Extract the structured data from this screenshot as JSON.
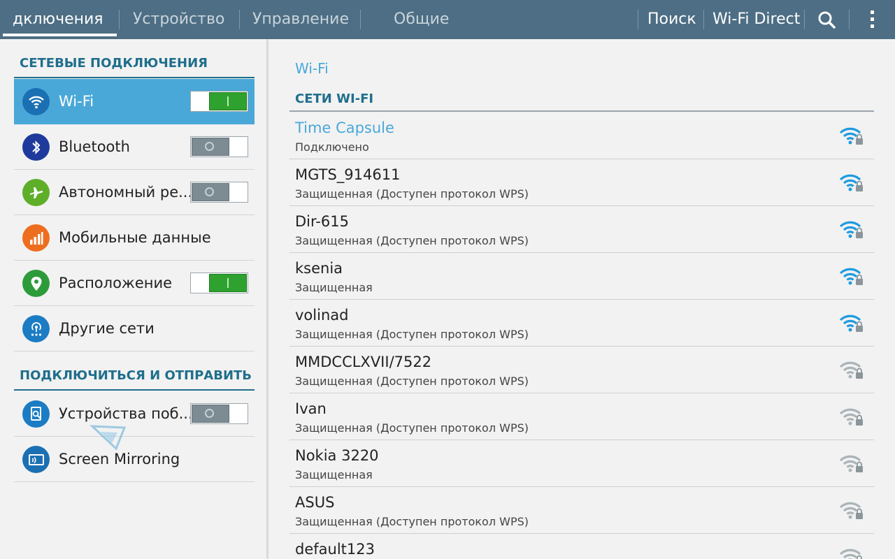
{
  "tabs": [
    {
      "label": "дключения"
    },
    {
      "label": "Устройство"
    },
    {
      "label": "Управление"
    },
    {
      "label": "Общие"
    }
  ],
  "actions": {
    "search_label": "Поиск",
    "wifi_direct_label": "Wi-Fi Direct"
  },
  "icons": {
    "search": "search-icon",
    "menu": "overflow-menu-icon"
  },
  "colors": {
    "topbar": "#4d6e84",
    "accent": "#4aa8d8",
    "section": "#1f6e8c",
    "toggle_on": "#2ea12e",
    "toggle_off": "#7d8b93"
  },
  "sidebar": {
    "section1": "СЕТЕВЫЕ ПОДКЛЮЧЕНИЯ",
    "items": [
      {
        "label": "Wi-Fi",
        "icon": "wifi-icon",
        "toggle": "on",
        "active": true
      },
      {
        "label": "Bluetooth",
        "icon": "bluetooth-icon",
        "toggle": "off"
      },
      {
        "label": "Автономный ре...",
        "icon": "airplane-icon",
        "toggle": "off"
      },
      {
        "label": "Мобильные данные",
        "icon": "mobile-data-icon",
        "toggle": null
      },
      {
        "label": "Расположение",
        "icon": "location-icon",
        "toggle": "on"
      },
      {
        "label": "Другие сети",
        "icon": "other-networks-icon",
        "toggle": null
      }
    ],
    "section2": "ПОДКЛЮЧИТЬСЯ И ОТПРАВИТЬ",
    "items2": [
      {
        "label": "Устройства поб...",
        "icon": "nearby-devices-icon",
        "toggle": "off"
      },
      {
        "label": "Screen Mirroring",
        "icon": "screen-mirroring-icon",
        "toggle": null
      }
    ]
  },
  "main": {
    "breadcrumb": "Wi-Fi",
    "list_header": "СЕТИ WI-FI",
    "networks": [
      {
        "name": "Time Capsule",
        "status": "Подключено",
        "connected": true,
        "signal": "strong"
      },
      {
        "name": "MGTS_914611",
        "status": "Защищенная (Доступен протокол WPS)",
        "signal": "strong"
      },
      {
        "name": "Dir-615",
        "status": "Защищенная (Доступен протокол WPS)",
        "signal": "strong"
      },
      {
        "name": "ksenia",
        "status": "Защищенная",
        "signal": "strong"
      },
      {
        "name": "volinad",
        "status": "Защищенная (Доступен протокол WPS)",
        "signal": "strong"
      },
      {
        "name": "MMDCCLXVII/7522",
        "status": "Защищенная (Доступен протокол WPS)",
        "signal": "weak"
      },
      {
        "name": "Ivan",
        "status": "Защищенная (Доступен протокол WPS)",
        "signal": "weak"
      },
      {
        "name": "Nokia 3220",
        "status": "Защищенная",
        "signal": "weak"
      },
      {
        "name": "ASUS",
        "status": "Защищенная (Доступен протокол WPS)",
        "signal": "weak"
      },
      {
        "name": "default123",
        "status": "",
        "signal": "weak"
      }
    ]
  }
}
